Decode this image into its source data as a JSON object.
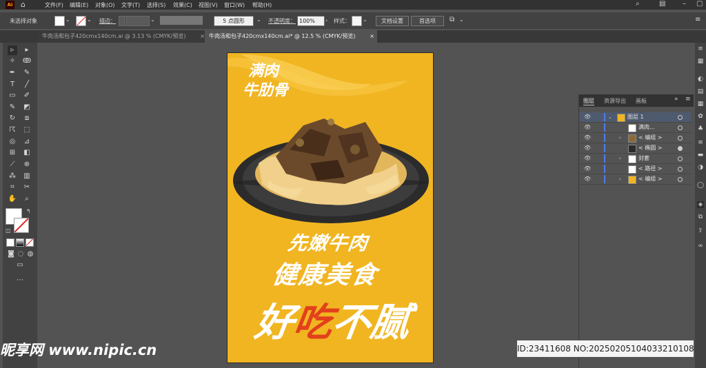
{
  "menu": {
    "logo": "Ai",
    "items": [
      "文件(F)",
      "编辑(E)",
      "对象(O)",
      "文字(T)",
      "选择(S)",
      "效果(C)",
      "视图(V)",
      "窗口(W)",
      "帮助(H)"
    ]
  },
  "control": {
    "selection_label": "未选择对象",
    "stroke_label": "描边：",
    "brush_label": "5 点圆形",
    "opacity_label": "不透明度：",
    "opacity_value": "100%",
    "style_label": "样式：",
    "doc_setup": "文档设置",
    "preferences": "首选项"
  },
  "tabs": [
    {
      "label": "牛肉汤和包子420cmx140cm.ai @ 3.13 % (CMYK/预览)",
      "active": false
    },
    {
      "label": "牛肉汤和包子420cmx140cm.ai* @ 12.5 % (CMYK/预览)",
      "active": true
    }
  ],
  "artboard": {
    "tag_line1": "满肉",
    "tag_line2": "牛肋骨",
    "headline1": "先嫩牛肉",
    "headline2": "健康美食",
    "headline3_a": "好",
    "headline3_b": "吃",
    "headline3_c": "不腻"
  },
  "layers_panel": {
    "tabs": [
      "图层",
      "资源导出",
      "画板"
    ],
    "rows": [
      {
        "name": "图层 1",
        "expanded": true
      },
      {
        "name": "满肉..."
      },
      {
        "name": "< 编组 >",
        "expandable": true
      },
      {
        "name": "< 椭圆 >"
      },
      {
        "name": "封套",
        "expandable": true
      },
      {
        "name": "< 路径 >"
      },
      {
        "name": "< 编组 >"
      }
    ]
  },
  "watermark": {
    "site": "昵享网 www.nipic.cn",
    "id_text": "ID:23411608 NO:20250205104033210108"
  },
  "colors": {
    "accent_yellow": "#f0b521",
    "red_text": "#e2401c",
    "panel_bg": "#535353",
    "bar_bg": "#323232"
  }
}
